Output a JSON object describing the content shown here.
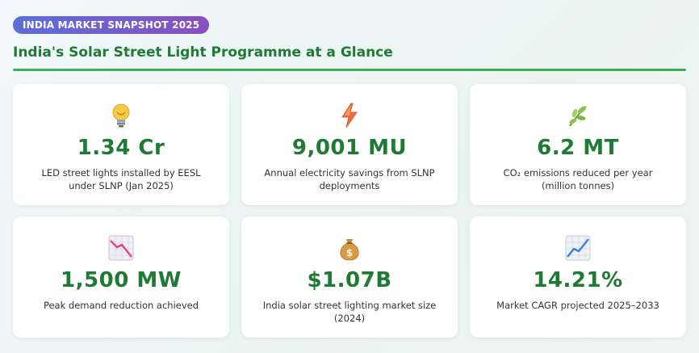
{
  "header": {
    "badge": "INDIA MARKET SNAPSHOT 2025",
    "title": "India's Solar Street Light Programme at a Glance"
  },
  "colors": {
    "accent_green": "#1f7a33",
    "rule_green": "#3fae54",
    "badge_start": "#5b6fd8",
    "badge_end": "#8a4fbf"
  },
  "cards": [
    {
      "icon": "lightbulb-icon",
      "value": "1.34 Cr",
      "desc": "LED street lights installed by EESL under SLNP (Jan 2025)"
    },
    {
      "icon": "lightning-icon",
      "value": "9,001 MU",
      "desc": "Annual electricity savings from SLNP deployments"
    },
    {
      "icon": "leaf-icon",
      "value": "6.2 MT",
      "desc": "CO₂ emissions reduced per year (million tonnes)"
    },
    {
      "icon": "chart-decreasing-icon",
      "value": "1,500 MW",
      "desc": "Peak demand reduction achieved"
    },
    {
      "icon": "money-bag-icon",
      "value": "$1.07B",
      "desc": "India solar street lighting market size (2024)"
    },
    {
      "icon": "chart-increasing-icon",
      "value": "14.21%",
      "desc": "Market CAGR projected 2025–2033"
    }
  ]
}
